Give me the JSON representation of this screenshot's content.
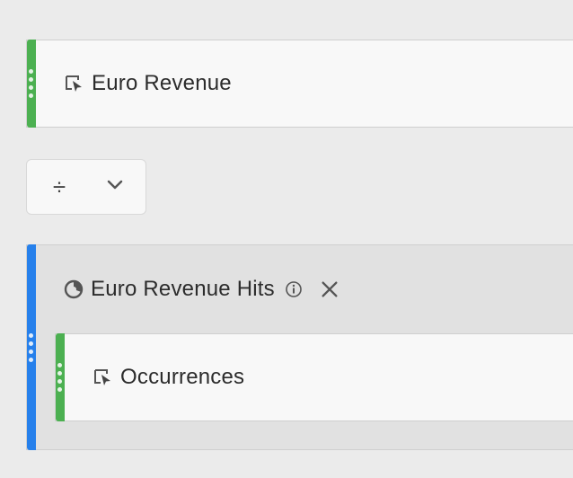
{
  "metric_card": {
    "label": "Euro Revenue",
    "icon": "metric-icon"
  },
  "operator": {
    "symbol": "÷",
    "dropdown_icon": "chevron-down-icon"
  },
  "segment": {
    "label": "Euro Revenue Hits",
    "icon": "segment-icon",
    "info_icon": "info-icon",
    "remove_icon": "close-icon",
    "inner_metric": {
      "label": "Occurrences",
      "icon": "metric-icon"
    }
  },
  "colors": {
    "metric_handle": "#4cb051",
    "segment_handle": "#2680eb",
    "background": "#ebebeb"
  }
}
